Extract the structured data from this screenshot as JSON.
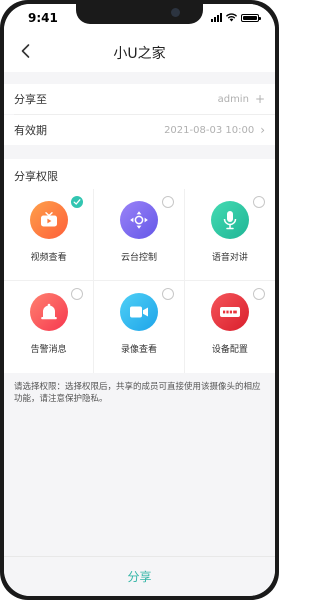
{
  "status": {
    "time": "9:41"
  },
  "nav": {
    "title": "小U之家"
  },
  "share_to": {
    "label": "分享至",
    "value": "admin",
    "action_glyph": "+"
  },
  "validity": {
    "label": "有效期",
    "value": "2021-08-03  10:00",
    "action_glyph": "›"
  },
  "permissions": {
    "header": "分享权限",
    "items": [
      {
        "label": "视频查看",
        "icon": "tv-icon",
        "color": "#fd7a3c",
        "checked": true
      },
      {
        "label": "云台控制",
        "icon": "ptz-icon",
        "color": "#7b6cf0",
        "checked": false
      },
      {
        "label": "语音对讲",
        "icon": "microphone-icon",
        "color": "#2bc7a4",
        "checked": false
      },
      {
        "label": "告警消息",
        "icon": "bell-icon",
        "color": "#fb5a5c",
        "checked": false
      },
      {
        "label": "录像查看",
        "icon": "video-camera-icon",
        "color": "#29b7ee",
        "checked": false
      },
      {
        "label": "设备配置",
        "icon": "device-config-icon",
        "color": "#e8343c",
        "checked": false
      }
    ]
  },
  "note": "请选择权限：选择权限后，共享的成员可直接使用该摄像头的相应功能，请注意保护隐私。",
  "share_button": "分享",
  "accent_color": "#32c5b1"
}
